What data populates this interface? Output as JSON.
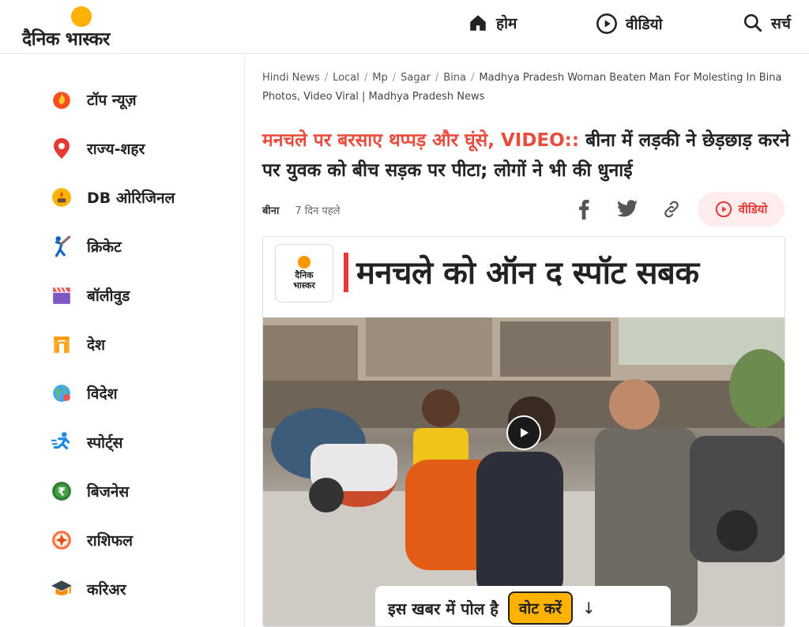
{
  "header": {
    "logo_text": "दैनिक भास्कर",
    "nav": [
      {
        "label": "होम",
        "icon": "home-icon"
      },
      {
        "label": "वीडियो",
        "icon": "play-circle-icon"
      },
      {
        "label": "सर्च",
        "icon": "search-icon"
      }
    ]
  },
  "sidebar": {
    "items": [
      {
        "label": "टॉप न्यूज़",
        "icon": "flame-icon"
      },
      {
        "label": "राज्य-शहर",
        "icon": "location-pin-icon"
      },
      {
        "label": "DB ओरिजिनल",
        "icon": "diya-icon"
      },
      {
        "label": "क्रिकेट",
        "icon": "cricket-icon"
      },
      {
        "label": "बॉलीवुड",
        "icon": "clapperboard-icon"
      },
      {
        "label": "देश",
        "icon": "india-gate-icon"
      },
      {
        "label": "विदेश",
        "icon": "globe-icon"
      },
      {
        "label": "स्पोर्ट्स",
        "icon": "runner-icon"
      },
      {
        "label": "बिजनेस",
        "icon": "rupee-icon"
      },
      {
        "label": "राशिफल",
        "icon": "zodiac-icon"
      },
      {
        "label": "करिअर",
        "icon": "graduation-cap-icon"
      }
    ]
  },
  "breadcrumb": {
    "items": [
      "Hindi News",
      "Local",
      "Mp",
      "Sagar",
      "Bina"
    ],
    "current": "Madhya Pradesh Woman Beaten Man For Molesting In Bina Photos, Video Viral | Madhya Pradesh News"
  },
  "article": {
    "headline_highlight": "मनचले पर बरसाए थप्पड़ और घूंसे, VIDEO::",
    "headline_rest": " बीना में लड़की ने छेड़छाड़ करने पर युवक को बीच सड़क पर पीटा; लोगों ने भी की धुनाई",
    "place": "बीना",
    "time": "7 दिन पहले",
    "video_button": "वीडियो",
    "share_icons": [
      "facebook-icon",
      "twitter-icon",
      "link-icon"
    ]
  },
  "media": {
    "logo_text_1": "दैनिक",
    "logo_text_2": "भास्कर",
    "banner_title": "मनचले को ऑन द स्पॉट सबक",
    "poll_question": "इस खबर में पोल है",
    "poll_button": "वोट करें",
    "poll_arrow": "↓"
  },
  "colors": {
    "accent_red": "#e94b3c",
    "logo_orange": "#ff9800",
    "poll_yellow": "#ffb300"
  }
}
